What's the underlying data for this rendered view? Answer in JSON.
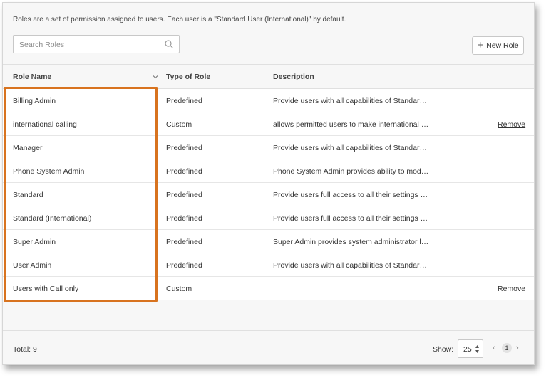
{
  "intro": "Roles are a set of permission assigned to users. Each user is a \"Standard User (International)\" by default.",
  "search": {
    "placeholder": "Search Roles"
  },
  "toolbar": {
    "new_role_label": "New Role"
  },
  "table": {
    "columns": {
      "name": "Role Name",
      "type": "Type of Role",
      "description": "Description"
    },
    "rows": [
      {
        "name": "Billing Admin",
        "type": "Predefined",
        "description": "Provide users with all capabilities of Standard (…",
        "action": ""
      },
      {
        "name": "international calling",
        "type": "Custom",
        "description": "allows permitted users to make international ca…",
        "action": "Remove"
      },
      {
        "name": "Manager",
        "type": "Predefined",
        "description": "Provide users with all capabilities of Standard (…",
        "action": ""
      },
      {
        "name": "Phone System Admin",
        "type": "Predefined",
        "description": "Phone System Admin provides ability to modify…",
        "action": ""
      },
      {
        "name": "Standard",
        "type": "Predefined",
        "description": "Provide users full access to all their settings & …",
        "action": ""
      },
      {
        "name": "Standard (International)",
        "type": "Predefined",
        "description": "Provide users full access to all their settings & …",
        "action": ""
      },
      {
        "name": "Super Admin",
        "type": "Predefined",
        "description": "Super Admin provides system administrator le…",
        "action": ""
      },
      {
        "name": "User Admin",
        "type": "Predefined",
        "description": "Provide users with all capabilities of Standard (…",
        "action": ""
      },
      {
        "name": "Users with Call only",
        "type": "Custom",
        "description": "",
        "action": "Remove"
      }
    ]
  },
  "footer": {
    "total": "Total: 9",
    "show_label": "Show:",
    "page_size": "25",
    "current_page": "1",
    "prev": "‹",
    "next": "›"
  },
  "colors": {
    "highlight": "#d8731f"
  },
  "icons": {
    "search": "search-icon",
    "new": "plus-icon",
    "sort": "chevron-down-icon",
    "select": "up-down-icon"
  }
}
